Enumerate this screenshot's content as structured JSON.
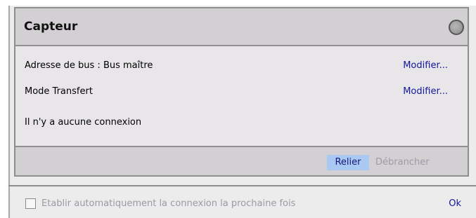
{
  "panel": {
    "title": "Capteur",
    "rows": [
      {
        "label": "Adresse de bus : Bus maître",
        "action": "Modifier..."
      },
      {
        "label": "Mode Transfert",
        "action": "Modifier..."
      },
      {
        "label": "Il n'y a aucune connexion"
      }
    ],
    "footer": {
      "relier_label": "Relier",
      "debrancher_label": "Débrancher"
    },
    "status_icon": "status-indicator-icon"
  },
  "bottom": {
    "checkbox_label": "Etablir automatiquement la connexion la prochaine fois",
    "checkbox_checked": false,
    "ok_label": "Ok"
  },
  "colors": {
    "accent_button": "#a9c8f2",
    "link": "#111899",
    "disabled_text": "#9c9aa6"
  }
}
